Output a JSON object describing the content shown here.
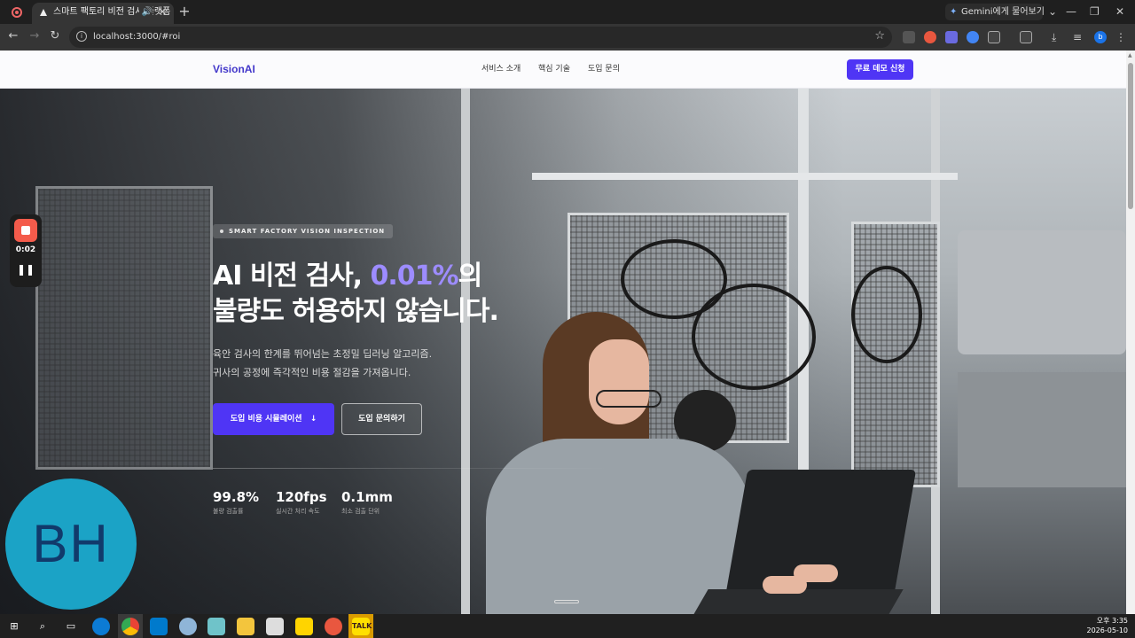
{
  "browser": {
    "tab_title": "스마트 팩토리 비전 검사 플랫폼",
    "gemini_button": "Gemini에게 물어보기",
    "url": "localhost:3000/#roi",
    "profile_initial": "b"
  },
  "nav": {
    "logo": "VisionAI",
    "links": [
      "서비스 소개",
      "핵심 기술",
      "도입 문의"
    ],
    "demo_button": "무료 데모 신청"
  },
  "hero": {
    "badge": "SMART FACTORY VISION INSPECTION",
    "headline_pre": "AI 비전 검사, ",
    "headline_highlight": "0.01%",
    "headline_post": "의",
    "headline_line2": "불량도 허용하지 않습니다.",
    "subtext_line1": "육안 검사의 한계를 뛰어넘는 초정밀 딥러닝 알고리즘.",
    "subtext_line2": "귀사의 공정에 즉각적인 비용 절감을 가져옵니다.",
    "primary_button": "도입 비용 시뮬레이션",
    "primary_button_icon": "↓",
    "secondary_button": "도입 문의하기",
    "stats": [
      {
        "value": "99.8%",
        "label": "불량 검출률"
      },
      {
        "value": "120fps",
        "label": "실시간 처리 속도"
      },
      {
        "value": "0.1mm",
        "label": "최소 검출 단위"
      }
    ]
  },
  "recorder": {
    "time": "0:02"
  },
  "avatar": {
    "initials": "BH"
  },
  "taskbar": {
    "time": "오후 3:35",
    "date": "2026-05-10"
  },
  "colors": {
    "brand": "#4f35f5",
    "highlight": "#9d8cff",
    "logo": "#4338ca"
  }
}
